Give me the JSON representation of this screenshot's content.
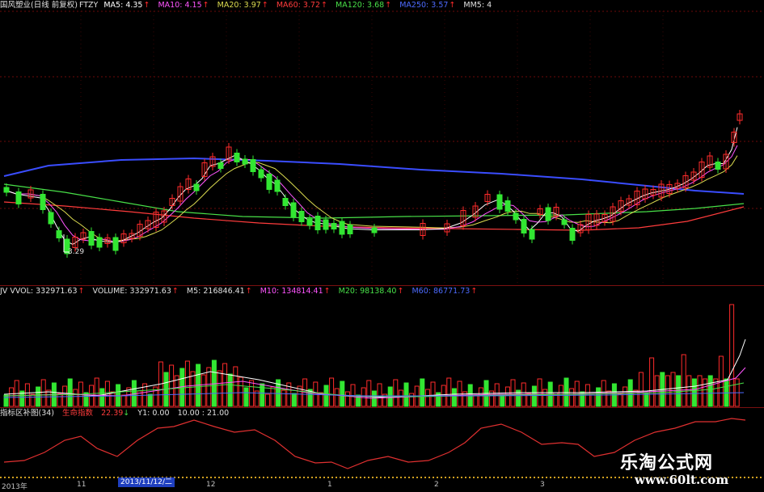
{
  "price_header": {
    "title": "国风塑业(日线 前复权)",
    "indicator": "FTZY",
    "ma5": "MA5: 4.35",
    "ma10": "MA10: 4.15",
    "ma20": "MA20: 3.97",
    "ma60": "MA60: 3.72",
    "ma120": "MA120: 3.68",
    "ma250": "MA250: 3.57",
    "mm5": "MM5: 4",
    "colors": {
      "ma5": "#ffffff",
      "ma10": "#ff55ff",
      "ma20": "#dcdc50",
      "ma60": "#ff3c3c",
      "ma120": "#48e048",
      "ma250": "#4d6bff"
    }
  },
  "price_panel": {
    "low_label": "3.29"
  },
  "volume_header": {
    "vol": "JV VVOL: 332971.63",
    "volume": "VOLUME: 332971.63",
    "m5": "M5: 216846.41",
    "m10": "M10: 134814.41",
    "m20": "M20: 98138.40",
    "m60": "M60: 86771.73"
  },
  "indicator_header": {
    "name": "指标区补图(34)",
    "label": "生命指数",
    "value": "22.39",
    "y1": "Y1: 0.00",
    "y2": "10.00 : 21.00"
  },
  "dates": {
    "year": "2013年",
    "m11": "11",
    "selected": "2013/11/12/二",
    "m12": "12",
    "m1": "1",
    "m2": "2",
    "m3": "3"
  },
  "watermark": {
    "title": "乐淘公式网",
    "url": "www.60lt.com"
  }
}
